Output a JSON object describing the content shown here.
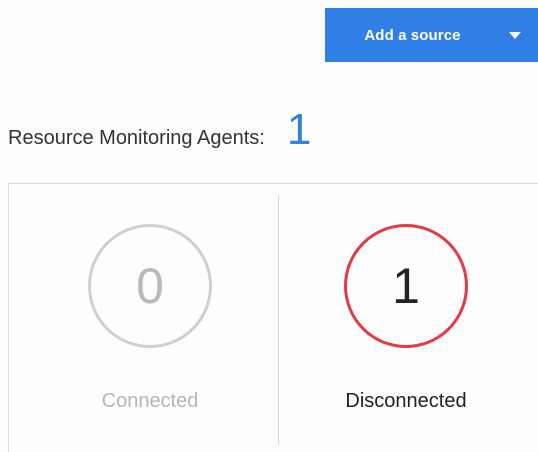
{
  "toolbar": {
    "add_source_label": "Add a source",
    "dropdown_icon": "caret-down-icon"
  },
  "agents": {
    "label": "Resource Monitoring Agents:",
    "count": "1"
  },
  "status": {
    "connected": {
      "value": "0",
      "label": "Connected",
      "ring_color": "#cfcfcf"
    },
    "disconnected": {
      "value": "1",
      "label": "Disconnected",
      "ring_color": "#e53a40"
    }
  },
  "colors": {
    "accent": "#2f7fe6",
    "alert": "#e53a40"
  }
}
